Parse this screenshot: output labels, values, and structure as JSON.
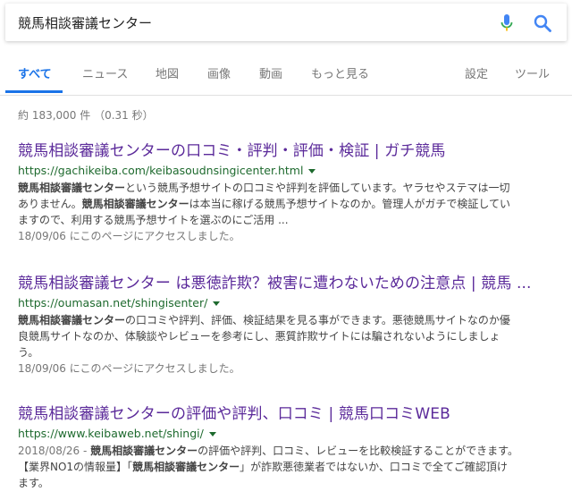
{
  "search": {
    "query": "競馬相談審議センター"
  },
  "icons": {
    "mic": "microphone-icon",
    "search": "search-icon",
    "mic_colors": [
      "#4285f4",
      "#34a853",
      "#fbbc05",
      "#ea4335"
    ],
    "search_color": "#4285f4"
  },
  "tabs": [
    "すべて",
    "ニュース",
    "地図",
    "画像",
    "動画",
    "もっと見る",
    "設定",
    "ツール"
  ],
  "stats": "約 183,000 件 （0.31 秒）",
  "results": [
    {
      "title": "競馬相談審議センターの口コミ・評判・評価・検証 | ガチ競馬",
      "url": "https://gachikeiba.com/keibasoudnsingicenter.html",
      "snippet": [
        [
          {
            "b": "競馬相談審議センター"
          },
          {
            "t": "という競馬予想サイトの口コミや評判を評価しています。ヤラセやステマは一切"
          }
        ],
        [
          {
            "t": "ありません。"
          },
          {
            "b": "競馬相談審議センター"
          },
          {
            "t": "は本当に稼げる競馬予想サイトなのか。管理人がガチで検証してい"
          }
        ],
        [
          {
            "t": "ますので、利用する競馬予想サイトを選ぶのにご活用 ..."
          }
        ]
      ],
      "visited": "18/09/06 にこのページにアクセスしました。"
    },
    {
      "title": "競馬相談審議センター は悪徳詐欺？被害に遭わないための注意点 | 競馬 ...",
      "url": "https://oumasan.net/shingisenter/",
      "snippet": [
        [
          {
            "b": "競馬相談審議センター"
          },
          {
            "t": "の口コミや評判、評価、検証結果を見る事ができます。悪徳競馬サイトなのか優"
          }
        ],
        [
          {
            "t": "良競馬サイトなのか、体験談やレビューを参考にし、悪質詐欺サイトには騙されないようにしましょ"
          }
        ],
        [
          {
            "t": "う。"
          }
        ]
      ],
      "visited": "18/09/06 にこのページにアクセスしました。"
    },
    {
      "title": "競馬相談審議センターの評価や評判、口コミ | 競馬口コミWEB",
      "url": "https://www.keibaweb.net/shingi/",
      "snippet": [
        [
          {
            "d": "2018/08/26 - "
          },
          {
            "b": "競馬相談審議センター"
          },
          {
            "t": "の評価や評判、口コミ、レビューを比較検証することができます。"
          }
        ],
        [
          {
            "t": "【業界NO1の情報量】「"
          },
          {
            "b": "競馬相談審議センター"
          },
          {
            "t": "」が詐欺悪徳業者ではないか、口コミで全てご確認頂け"
          }
        ],
        [
          {
            "t": "ます。"
          }
        ]
      ],
      "visited": ""
    }
  ]
}
